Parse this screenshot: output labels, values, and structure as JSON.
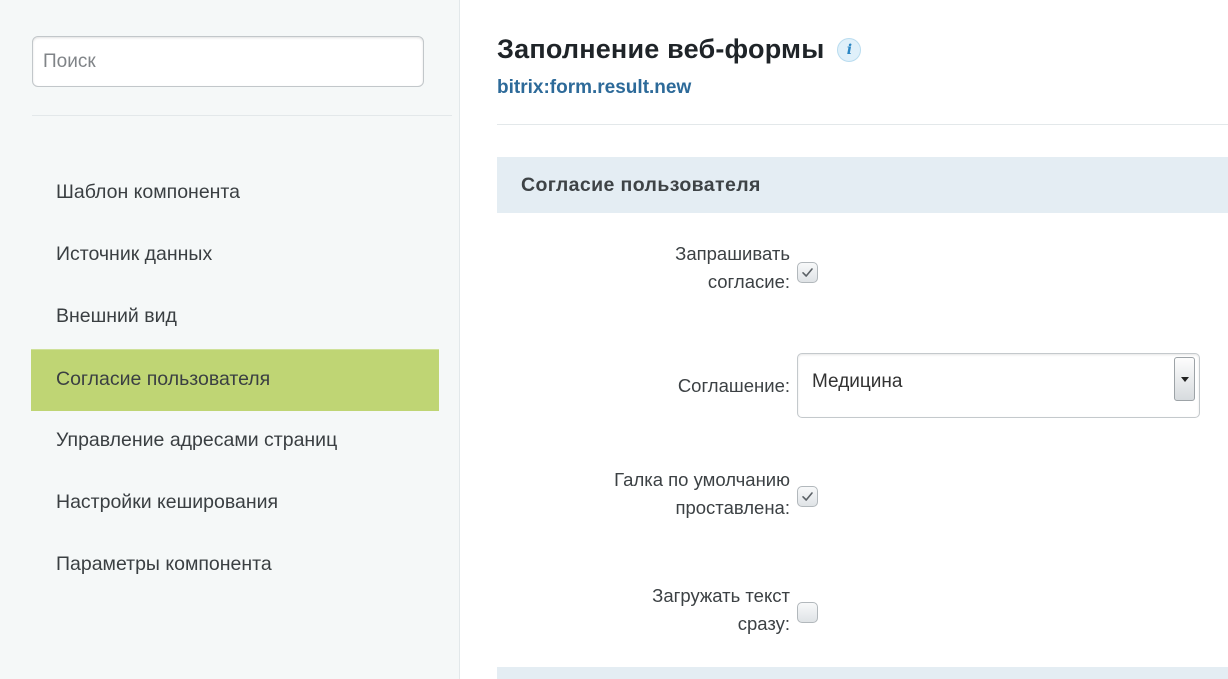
{
  "search": {
    "placeholder": "Поиск"
  },
  "sidebar": {
    "items": [
      {
        "label": "Шаблон компонента"
      },
      {
        "label": "Источник данных"
      },
      {
        "label": "Внешний вид"
      },
      {
        "label": "Согласие пользователя",
        "active": true
      },
      {
        "label": "Управление адресами страниц"
      },
      {
        "label": "Настройки кеширования"
      },
      {
        "label": "Параметры компонента"
      }
    ]
  },
  "header": {
    "title": "Заполнение веб-формы",
    "info_icon": "i",
    "component_id": "bitrix:form.result.new"
  },
  "section": {
    "title": "Согласие пользователя",
    "fields": {
      "ask_consent": {
        "label_line1": "Запрашивать",
        "label_line2": "согласие:",
        "checked": true
      },
      "agreement": {
        "label": "Соглашение:",
        "value": "Медицина"
      },
      "default_checked": {
        "label_line1": "Галка по умолчанию",
        "label_line2": "проставлена:",
        "checked": true
      },
      "load_text": {
        "label_line1": "Загружать текст",
        "label_line2": "сразу:",
        "checked": false
      }
    }
  },
  "colors": {
    "active_nav": "#bfd574",
    "section_header": "#e4edf3",
    "link": "#2d6a99",
    "sidebar_bg": "#f5f8f8"
  }
}
